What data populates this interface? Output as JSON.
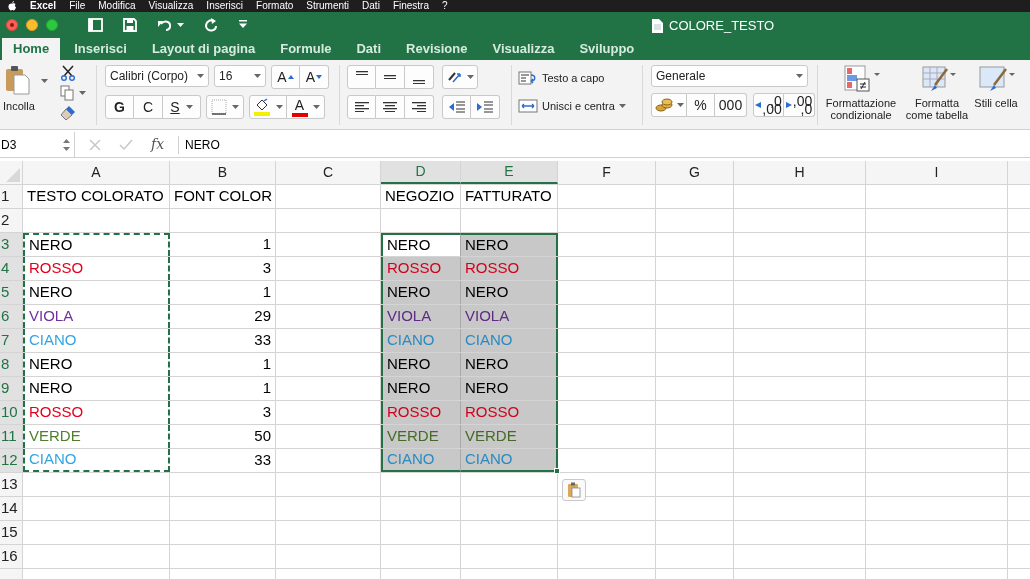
{
  "menu_bar": {
    "app": "Excel",
    "items": [
      "File",
      "Modifica",
      "Visualizza",
      "Inserisci",
      "Formato",
      "Strumenti",
      "Dati",
      "Finestra",
      "?"
    ]
  },
  "window": {
    "title": "COLORE_TESTO"
  },
  "tabs": [
    {
      "label": "Home",
      "selected": true
    },
    {
      "label": "Inserisci",
      "selected": false
    },
    {
      "label": "Layout di pagina",
      "selected": false
    },
    {
      "label": "Formule",
      "selected": false
    },
    {
      "label": "Dati",
      "selected": false
    },
    {
      "label": "Revisione",
      "selected": false
    },
    {
      "label": "Visualizza",
      "selected": false
    },
    {
      "label": "Sviluppo",
      "selected": false
    }
  ],
  "ribbon": {
    "paste_label": "Incolla",
    "font_name": "Calibri (Corpo)",
    "font_size": "16",
    "grow_font": "A",
    "shrink_font": "A",
    "bold": "G",
    "italic": "C",
    "underline": "S",
    "font_color": "A",
    "wrap_text": "Testo a capo",
    "merge": "Unisci e centra",
    "number_format": "Generale",
    "percent": "%",
    "thousands": "000",
    "increase_decimals": [
      ",0",
      ",00"
    ],
    "decrease_decimals": [
      ",00",
      ",0"
    ],
    "conditional_formatting": "Formattazione condizionale",
    "format_as_table": "Formatta come tabella",
    "cell_styles": "Stili cella"
  },
  "formula_bar": {
    "name_box": "D3",
    "fx": "fx",
    "value": "NERO"
  },
  "sheet": {
    "columns": [
      {
        "label": "A",
        "selected": false
      },
      {
        "label": "B",
        "selected": false
      },
      {
        "label": "C",
        "selected": false
      },
      {
        "label": "D",
        "selected": true
      },
      {
        "label": "E",
        "selected": true
      },
      {
        "label": "F",
        "selected": false
      },
      {
        "label": "G",
        "selected": false
      },
      {
        "label": "H",
        "selected": false
      },
      {
        "label": "I",
        "selected": false
      }
    ],
    "rows": [
      {
        "number": "1",
        "selected": false,
        "a": {
          "text": "TESTO COLORATO"
        },
        "b": {
          "text": "FONT COLOR"
        },
        "d": {
          "text": "NEGOZIO"
        },
        "e": {
          "text": "FATTURATO"
        }
      },
      {
        "number": "2",
        "selected": false
      },
      {
        "number": "3",
        "selected": true,
        "a": {
          "text": "NERO",
          "color": "#000000",
          "marquee": true
        },
        "b": {
          "text": "1",
          "numeric": true
        },
        "d": {
          "text": "NERO",
          "color": "#000000",
          "selected": true,
          "active": true
        },
        "e": {
          "text": "NERO",
          "color": "#000000",
          "selected": true
        }
      },
      {
        "number": "4",
        "selected": true,
        "a": {
          "text": "ROSSO",
          "color": "#e3001b",
          "marquee": true
        },
        "b": {
          "text": "3",
          "numeric": true
        },
        "d": {
          "text": "ROSSO",
          "color": "#d0021b",
          "selected": true
        },
        "e": {
          "text": "ROSSO",
          "color": "#d0021b",
          "selected": true
        }
      },
      {
        "number": "5",
        "selected": true,
        "a": {
          "text": "NERO",
          "color": "#000000",
          "marquee": true
        },
        "b": {
          "text": "1",
          "numeric": true
        },
        "d": {
          "text": "NERO",
          "color": "#000000",
          "selected": true
        },
        "e": {
          "text": "NERO",
          "color": "#000000",
          "selected": true
        }
      },
      {
        "number": "6",
        "selected": true,
        "a": {
          "text": "VIOLA",
          "color": "#7030a0",
          "marquee": true
        },
        "b": {
          "text": "29",
          "numeric": true
        },
        "d": {
          "text": "VIOLA",
          "color": "#5e2a86",
          "selected": true
        },
        "e": {
          "text": "VIOLA",
          "color": "#5e2a86",
          "selected": true
        }
      },
      {
        "number": "7",
        "selected": true,
        "a": {
          "text": "CIANO",
          "color": "#33a4e0",
          "marquee": true
        },
        "b": {
          "text": "33",
          "numeric": true
        },
        "d": {
          "text": "CIANO",
          "color": "#2b8ac0",
          "selected": true
        },
        "e": {
          "text": "CIANO",
          "color": "#2b8ac0",
          "selected": true
        }
      },
      {
        "number": "8",
        "selected": true,
        "a": {
          "text": "NERO",
          "color": "#000000",
          "marquee": true
        },
        "b": {
          "text": "1",
          "numeric": true
        },
        "d": {
          "text": "NERO",
          "color": "#000000",
          "selected": true
        },
        "e": {
          "text": "NERO",
          "color": "#000000",
          "selected": true
        }
      },
      {
        "number": "9",
        "selected": true,
        "a": {
          "text": "NERO",
          "color": "#000000",
          "marquee": true
        },
        "b": {
          "text": "1",
          "numeric": true
        },
        "d": {
          "text": "NERO",
          "color": "#000000",
          "selected": true
        },
        "e": {
          "text": "NERO",
          "color": "#000000",
          "selected": true
        }
      },
      {
        "number": "10",
        "selected": true,
        "a": {
          "text": "ROSSO",
          "color": "#e3001b",
          "marquee": true
        },
        "b": {
          "text": "3",
          "numeric": true
        },
        "d": {
          "text": "ROSSO",
          "color": "#d0021b",
          "selected": true
        },
        "e": {
          "text": "ROSSO",
          "color": "#d0021b",
          "selected": true
        }
      },
      {
        "number": "11",
        "selected": true,
        "a": {
          "text": "VERDE",
          "color": "#4f7f2a",
          "marquee": true
        },
        "b": {
          "text": "50",
          "numeric": true
        },
        "d": {
          "text": "VERDE",
          "color": "#466a26",
          "selected": true
        },
        "e": {
          "text": "VERDE",
          "color": "#466a26",
          "selected": true
        }
      },
      {
        "number": "12",
        "selected": true,
        "a": {
          "text": "CIANO",
          "color": "#33a4e0",
          "marquee": true
        },
        "b": {
          "text": "33",
          "numeric": true
        },
        "d": {
          "text": "CIANO",
          "color": "#2b8ac0",
          "selected": true
        },
        "e": {
          "text": "CIANO",
          "color": "#2b8ac0",
          "selected": true
        }
      },
      {
        "number": "13",
        "selected": false
      },
      {
        "number": "14",
        "selected": false
      },
      {
        "number": "15",
        "selected": false
      },
      {
        "number": "16",
        "selected": false
      }
    ]
  }
}
